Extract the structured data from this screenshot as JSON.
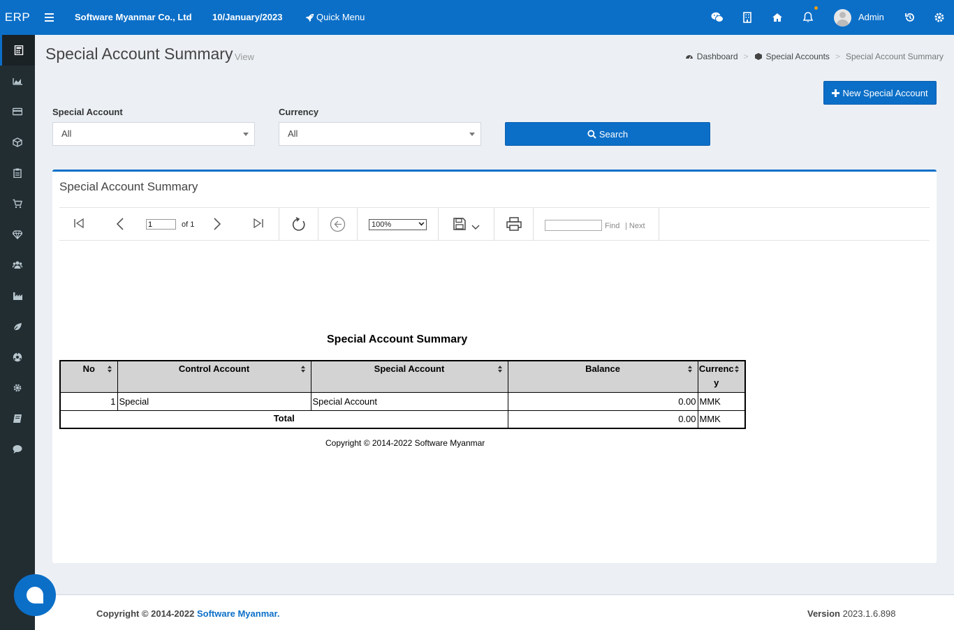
{
  "app": {
    "brand": "ERP",
    "company": "Software Myanmar Co., Ltd",
    "date": "10/January/2023",
    "quick_menu": "Quick Menu",
    "user": "Admin",
    "accent": "#0b6fc8"
  },
  "topbar_icons": [
    "menu-icon",
    "wechat-icon",
    "building-icon",
    "home-icon",
    "bell-icon",
    "history-icon",
    "gear-icon"
  ],
  "sidebar_icons": [
    "calculator-icon",
    "area-chart-icon",
    "credit-card-icon",
    "cube-icon",
    "clipboard-icon",
    "cart-icon",
    "diamond-icon",
    "users-icon",
    "industry-icon",
    "leaf-icon",
    "soccer-ball-icon",
    "cog-icon",
    "book-icon",
    "comment-icon"
  ],
  "page": {
    "title": "Special Account Summary",
    "subtitle": "View"
  },
  "breadcrumb": {
    "dashboard": "Dashboard",
    "special_accounts": "Special Accounts",
    "current": "Special Account Summary"
  },
  "actions": {
    "new_label": "New Special Account",
    "search_label": "Search"
  },
  "filters": {
    "special_account_label": "Special Account",
    "special_account_value": "All",
    "currency_label": "Currency",
    "currency_value": "All"
  },
  "box": {
    "title": "Special Account Summary"
  },
  "viewer": {
    "page_number": "1",
    "of_pages": "of 1",
    "zoom": "100%",
    "find": "Find",
    "next": "Next"
  },
  "report": {
    "title": "Special Account Summary",
    "columns": [
      "No",
      "Control Account",
      "Special Account",
      "Balance",
      "Currency"
    ],
    "rows": [
      {
        "no": "1",
        "control_account": "Special",
        "special_account": "Special Account",
        "balance": "0.00",
        "currency": "MMK"
      }
    ],
    "total_label": "Total",
    "total_balance": "0.00",
    "total_currency": "MMK",
    "copyright": "Copyright © 2014-2022 Software Myanmar"
  },
  "footer": {
    "copyright_prefix": "Copyright © 2014-2022 ",
    "company_link": "Software Myanmar.",
    "version_label": "Version",
    "version": "2023.1.6.898"
  }
}
